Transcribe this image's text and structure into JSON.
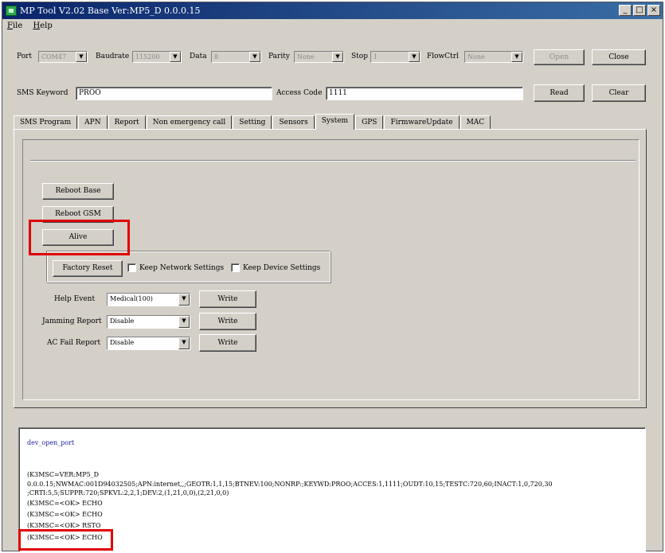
{
  "window": {
    "title": "MP Tool V2.02  Base Ver:MP5_D 0.0.0.15",
    "controls": [
      "_",
      "□",
      "×"
    ]
  },
  "menu": [
    {
      "key": "F",
      "rest": "ile"
    },
    {
      "key": "H",
      "rest": "elp"
    }
  ],
  "serial": {
    "port_label": "Port",
    "port_value": "COM47",
    "baud_label": "Baudrate",
    "baud_value": "115200",
    "data_label": "Data",
    "data_value": "8",
    "parity_label": "Parity",
    "parity_value": "None",
    "stop_label": "Stop",
    "stop_value": "1",
    "flow_label": "FlowCtrl",
    "flow_value": "None",
    "open_label": "Open",
    "close_label": "Close"
  },
  "sms": {
    "keyword_label": "SMS Keyword",
    "keyword_value": "PROO",
    "access_label": "Access Code",
    "access_value": "1111",
    "read_label": "Read",
    "clear_label": "Clear"
  },
  "tabs": [
    "SMS Program",
    "APN",
    "Report",
    "Non emergency call",
    "Setting",
    "Sensors",
    "System",
    "GPS",
    "FirmwareUpdate",
    "MAC"
  ],
  "active_tab": "System",
  "system": {
    "reboot_base": "Reboot Base",
    "reboot_gsm": "Reboot GSM",
    "alive": "Alive",
    "factory_reset": "Factory Reset",
    "keep_network": "Keep Network Settings",
    "keep_device": "Keep Device Settings",
    "help_event_label": "Help Event",
    "help_event_value": "Medical(100)",
    "jamming_label": "Jamming Report",
    "jamming_value": "Disable",
    "acfail_label": "AC Fail Report",
    "acfail_value": "Disable",
    "write_label": "Write"
  },
  "log": {
    "first": "dev_open_port",
    "lines": [
      "(K3MSC=VER:MP5_D",
      "0.0.0.15;NWMAC:001D94032505;APN:internet,,;GEOTR:1,1,15;BTNEV:100;NONRP:;KEYWD:PROO;ACCES:1,1111;OUDT:10,15;TESTC:720,60;INACT:1,0,720,30",
      ";CRTI:5,5;SUPPR:720;SPKVL:2,2,1;DEV:2,(1,21,0,0),(2,21,0,0)",
      "(K3MSC=<OK> ECHO",
      "(K3MSC=<OK> ECHO",
      "(K3MSC=<OK> RSTO",
      "(K3MSC=<OK> ECHO"
    ]
  }
}
